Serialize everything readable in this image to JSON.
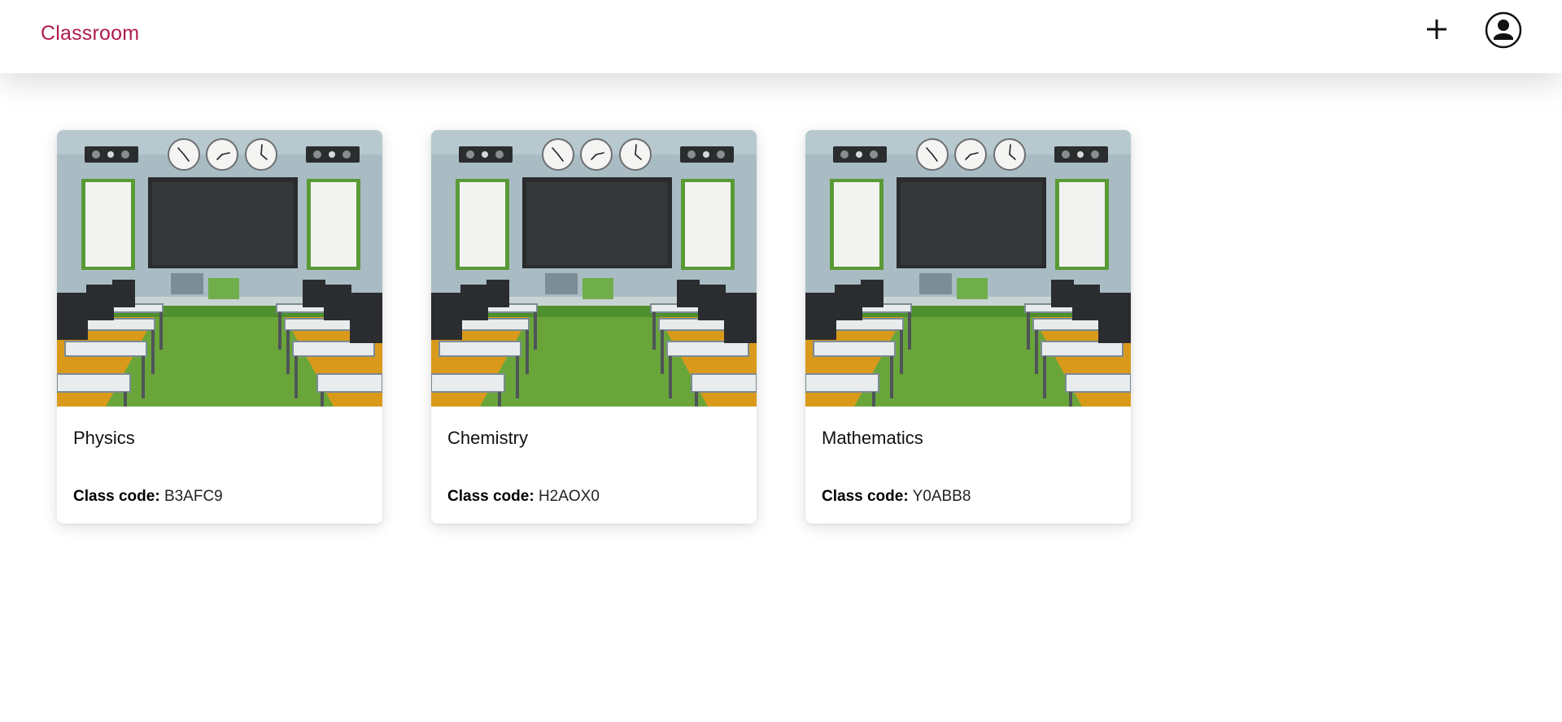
{
  "header": {
    "brand": "Classroom",
    "add_icon": "plus-icon",
    "avatar_icon": "account-circle-icon"
  },
  "colors": {
    "brand": "#b01a4f"
  },
  "cards": [
    {
      "title": "Physics",
      "code_label": "Class code:",
      "code": "B3AFC9",
      "image": "classroom-photo"
    },
    {
      "title": "Chemistry",
      "code_label": "Class code:",
      "code": "H2AOX0",
      "image": "classroom-photo"
    },
    {
      "title": "Mathematics",
      "code_label": "Class code:",
      "code": "Y0ABB8",
      "image": "classroom-photo"
    }
  ]
}
